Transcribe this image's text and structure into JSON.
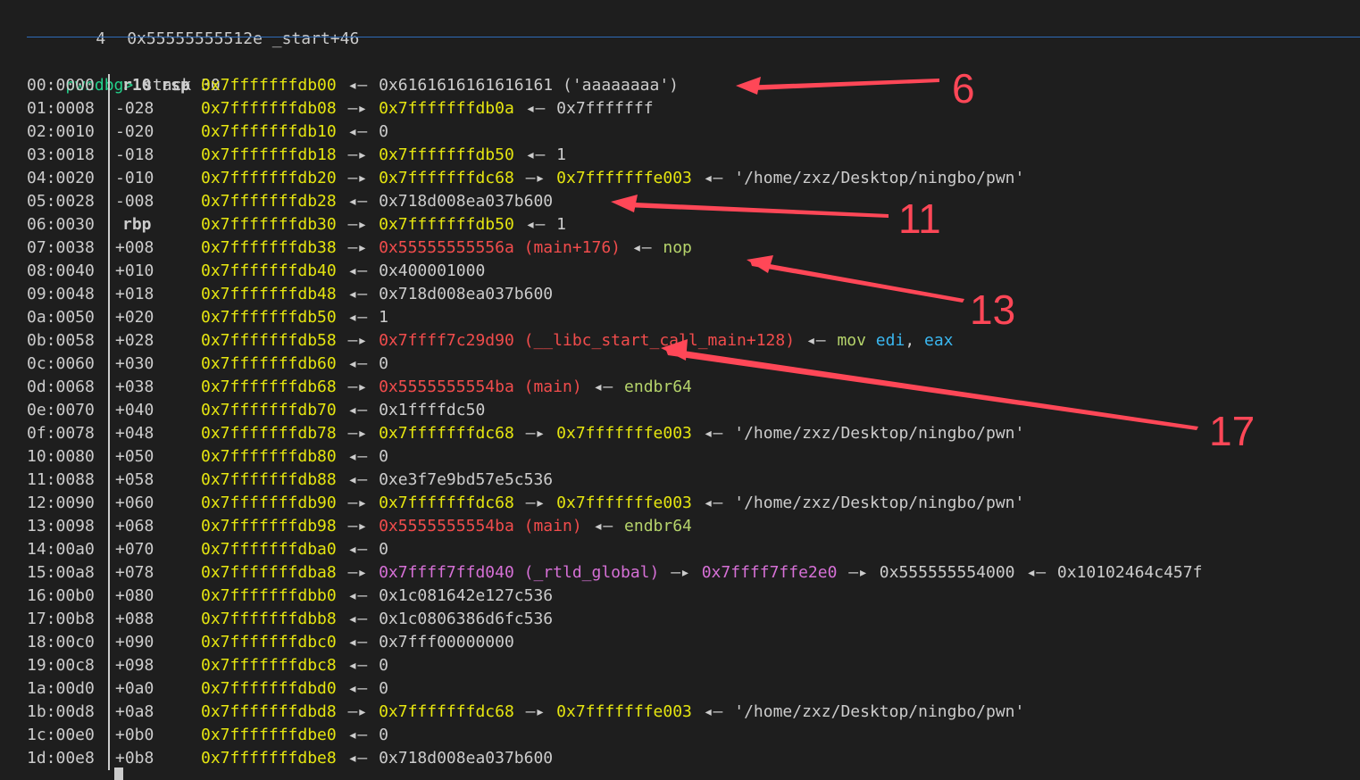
{
  "top": {
    "num": "4",
    "text": "0x55555555512e _start+46"
  },
  "prompt": {
    "label": "pwndbg>",
    "command": " stack 30"
  },
  "rows": [
    {
      "idx": "00:0000",
      "off": "r10 rsp",
      "isreg": true,
      "parts": [
        {
          "t": "addr",
          "v": "0x7fffffffdb00"
        },
        {
          "t": "arrow",
          "v": " ◂— "
        },
        {
          "t": "val",
          "v": "0x6161616161616161 ('aaaaaaaa')"
        }
      ]
    },
    {
      "idx": "01:0008",
      "off": "-028",
      "parts": [
        {
          "t": "addr",
          "v": "0x7fffffffdb08"
        },
        {
          "t": "arrow",
          "v": " —▸ "
        },
        {
          "t": "addr",
          "v": "0x7fffffffdb0a"
        },
        {
          "t": "arrow",
          "v": " ◂— "
        },
        {
          "t": "val",
          "v": "0x7fffffff"
        }
      ]
    },
    {
      "idx": "02:0010",
      "off": "-020",
      "parts": [
        {
          "t": "addr",
          "v": "0x7fffffffdb10"
        },
        {
          "t": "arrow",
          "v": " ◂— "
        },
        {
          "t": "val",
          "v": "0"
        }
      ]
    },
    {
      "idx": "03:0018",
      "off": "-018",
      "parts": [
        {
          "t": "addr",
          "v": "0x7fffffffdb18"
        },
        {
          "t": "arrow",
          "v": " —▸ "
        },
        {
          "t": "addr",
          "v": "0x7fffffffdb50"
        },
        {
          "t": "arrow",
          "v": " ◂— "
        },
        {
          "t": "val",
          "v": "1"
        }
      ]
    },
    {
      "idx": "04:0020",
      "off": "-010",
      "parts": [
        {
          "t": "addr",
          "v": "0x7fffffffdb20"
        },
        {
          "t": "arrow",
          "v": " —▸ "
        },
        {
          "t": "addr",
          "v": "0x7fffffffdc68"
        },
        {
          "t": "arrow",
          "v": " —▸ "
        },
        {
          "t": "addr",
          "v": "0x7fffffffe003"
        },
        {
          "t": "arrow",
          "v": " ◂— "
        },
        {
          "t": "val",
          "v": "'/home/zxz/Desktop/ningbo/pwn'"
        }
      ]
    },
    {
      "idx": "05:0028",
      "off": "-008",
      "parts": [
        {
          "t": "addr",
          "v": "0x7fffffffdb28"
        },
        {
          "t": "arrow",
          "v": " ◂— "
        },
        {
          "t": "val",
          "v": "0x718d008ea037b600"
        }
      ]
    },
    {
      "idx": "06:0030",
      "off": "rbp",
      "isreg": true,
      "parts": [
        {
          "t": "addr",
          "v": "0x7fffffffdb30"
        },
        {
          "t": "arrow",
          "v": " —▸ "
        },
        {
          "t": "addr",
          "v": "0x7fffffffdb50"
        },
        {
          "t": "arrow",
          "v": " ◂— "
        },
        {
          "t": "val",
          "v": "1"
        }
      ]
    },
    {
      "idx": "07:0038",
      "off": "+008",
      "parts": [
        {
          "t": "addr",
          "v": "0x7fffffffdb38"
        },
        {
          "t": "arrow",
          "v": " —▸ "
        },
        {
          "t": "code",
          "v": "0x55555555556a (main+176)"
        },
        {
          "t": "arrow",
          "v": " ◂— "
        },
        {
          "t": "instr",
          "v": "nop"
        }
      ]
    },
    {
      "idx": "08:0040",
      "off": "+010",
      "parts": [
        {
          "t": "addr",
          "v": "0x7fffffffdb40"
        },
        {
          "t": "arrow",
          "v": " ◂— "
        },
        {
          "t": "val",
          "v": "0x400001000"
        }
      ]
    },
    {
      "idx": "09:0048",
      "off": "+018",
      "parts": [
        {
          "t": "addr",
          "v": "0x7fffffffdb48"
        },
        {
          "t": "arrow",
          "v": " ◂— "
        },
        {
          "t": "val",
          "v": "0x718d008ea037b600"
        }
      ]
    },
    {
      "idx": "0a:0050",
      "off": "+020",
      "parts": [
        {
          "t": "addr",
          "v": "0x7fffffffdb50"
        },
        {
          "t": "arrow",
          "v": " ◂— "
        },
        {
          "t": "val",
          "v": "1"
        }
      ]
    },
    {
      "idx": "0b:0058",
      "off": "+028",
      "parts": [
        {
          "t": "addr",
          "v": "0x7fffffffdb58"
        },
        {
          "t": "arrow",
          "v": " —▸ "
        },
        {
          "t": "code",
          "v": "0x7ffff7c29d90 (__libc_start_call_main+128)"
        },
        {
          "t": "arrow",
          "v": " ◂— "
        },
        {
          "t": "instr",
          "v": "mov "
        },
        {
          "t": "reg",
          "v": "edi"
        },
        {
          "t": "val",
          "v": ", "
        },
        {
          "t": "reg",
          "v": "eax"
        }
      ]
    },
    {
      "idx": "0c:0060",
      "off": "+030",
      "parts": [
        {
          "t": "addr",
          "v": "0x7fffffffdb60"
        },
        {
          "t": "arrow",
          "v": " ◂— "
        },
        {
          "t": "val",
          "v": "0"
        }
      ]
    },
    {
      "idx": "0d:0068",
      "off": "+038",
      "parts": [
        {
          "t": "addr",
          "v": "0x7fffffffdb68"
        },
        {
          "t": "arrow",
          "v": " —▸ "
        },
        {
          "t": "code",
          "v": "0x5555555554ba (main)"
        },
        {
          "t": "arrow",
          "v": " ◂— "
        },
        {
          "t": "instr",
          "v": "endbr64"
        }
      ]
    },
    {
      "idx": "0e:0070",
      "off": "+040",
      "parts": [
        {
          "t": "addr",
          "v": "0x7fffffffdb70"
        },
        {
          "t": "arrow",
          "v": " ◂— "
        },
        {
          "t": "val",
          "v": "0x1ffffdc50"
        }
      ]
    },
    {
      "idx": "0f:0078",
      "off": "+048",
      "parts": [
        {
          "t": "addr",
          "v": "0x7fffffffdb78"
        },
        {
          "t": "arrow",
          "v": " —▸ "
        },
        {
          "t": "addr",
          "v": "0x7fffffffdc68"
        },
        {
          "t": "arrow",
          "v": " —▸ "
        },
        {
          "t": "addr",
          "v": "0x7fffffffe003"
        },
        {
          "t": "arrow",
          "v": " ◂— "
        },
        {
          "t": "val",
          "v": "'/home/zxz/Desktop/ningbo/pwn'"
        }
      ]
    },
    {
      "idx": "10:0080",
      "off": "+050",
      "parts": [
        {
          "t": "addr",
          "v": "0x7fffffffdb80"
        },
        {
          "t": "arrow",
          "v": " ◂— "
        },
        {
          "t": "val",
          "v": "0"
        }
      ]
    },
    {
      "idx": "11:0088",
      "off": "+058",
      "parts": [
        {
          "t": "addr",
          "v": "0x7fffffffdb88"
        },
        {
          "t": "arrow",
          "v": " ◂— "
        },
        {
          "t": "val",
          "v": "0xe3f7e9bd57e5c536"
        }
      ]
    },
    {
      "idx": "12:0090",
      "off": "+060",
      "parts": [
        {
          "t": "addr",
          "v": "0x7fffffffdb90"
        },
        {
          "t": "arrow",
          "v": " —▸ "
        },
        {
          "t": "addr",
          "v": "0x7fffffffdc68"
        },
        {
          "t": "arrow",
          "v": " —▸ "
        },
        {
          "t": "addr",
          "v": "0x7fffffffe003"
        },
        {
          "t": "arrow",
          "v": " ◂— "
        },
        {
          "t": "val",
          "v": "'/home/zxz/Desktop/ningbo/pwn'"
        }
      ]
    },
    {
      "idx": "13:0098",
      "off": "+068",
      "parts": [
        {
          "t": "addr",
          "v": "0x7fffffffdb98"
        },
        {
          "t": "arrow",
          "v": " —▸ "
        },
        {
          "t": "code",
          "v": "0x5555555554ba (main)"
        },
        {
          "t": "arrow",
          "v": " ◂— "
        },
        {
          "t": "instr",
          "v": "endbr64"
        }
      ]
    },
    {
      "idx": "14:00a0",
      "off": "+070",
      "parts": [
        {
          "t": "addr",
          "v": "0x7fffffffdba0"
        },
        {
          "t": "arrow",
          "v": " ◂— "
        },
        {
          "t": "val",
          "v": "0"
        }
      ]
    },
    {
      "idx": "15:00a8",
      "off": "+078",
      "parts": [
        {
          "t": "addr",
          "v": "0x7fffffffdba8"
        },
        {
          "t": "arrow",
          "v": " —▸ "
        },
        {
          "t": "data",
          "v": "0x7ffff7ffd040 (_rtld_global)"
        },
        {
          "t": "arrow",
          "v": " —▸ "
        },
        {
          "t": "data",
          "v": "0x7ffff7ffe2e0"
        },
        {
          "t": "arrow",
          "v": " —▸ "
        },
        {
          "t": "val",
          "v": "0x555555554000"
        },
        {
          "t": "arrow",
          "v": " ◂— "
        },
        {
          "t": "val",
          "v": "0x10102464c457f"
        }
      ]
    },
    {
      "idx": "16:00b0",
      "off": "+080",
      "parts": [
        {
          "t": "addr",
          "v": "0x7fffffffdbb0"
        },
        {
          "t": "arrow",
          "v": " ◂— "
        },
        {
          "t": "val",
          "v": "0x1c081642e127c536"
        }
      ]
    },
    {
      "idx": "17:00b8",
      "off": "+088",
      "parts": [
        {
          "t": "addr",
          "v": "0x7fffffffdbb8"
        },
        {
          "t": "arrow",
          "v": " ◂— "
        },
        {
          "t": "val",
          "v": "0x1c0806386d6fc536"
        }
      ]
    },
    {
      "idx": "18:00c0",
      "off": "+090",
      "parts": [
        {
          "t": "addr",
          "v": "0x7fffffffdbc0"
        },
        {
          "t": "arrow",
          "v": " ◂— "
        },
        {
          "t": "val",
          "v": "0x7fff00000000"
        }
      ]
    },
    {
      "idx": "19:00c8",
      "off": "+098",
      "parts": [
        {
          "t": "addr",
          "v": "0x7fffffffdbc8"
        },
        {
          "t": "arrow",
          "v": " ◂— "
        },
        {
          "t": "val",
          "v": "0"
        }
      ]
    },
    {
      "idx": "1a:00d0",
      "off": "+0a0",
      "parts": [
        {
          "t": "addr",
          "v": "0x7fffffffdbd0"
        },
        {
          "t": "arrow",
          "v": " ◂— "
        },
        {
          "t": "val",
          "v": "0"
        }
      ]
    },
    {
      "idx": "1b:00d8",
      "off": "+0a8",
      "parts": [
        {
          "t": "addr",
          "v": "0x7fffffffdbd8"
        },
        {
          "t": "arrow",
          "v": " —▸ "
        },
        {
          "t": "addr",
          "v": "0x7fffffffdc68"
        },
        {
          "t": "arrow",
          "v": " —▸ "
        },
        {
          "t": "addr",
          "v": "0x7fffffffe003"
        },
        {
          "t": "arrow",
          "v": " ◂— "
        },
        {
          "t": "val",
          "v": "'/home/zxz/Desktop/ningbo/pwn'"
        }
      ]
    },
    {
      "idx": "1c:00e0",
      "off": "+0b0",
      "parts": [
        {
          "t": "addr",
          "v": "0x7fffffffdbe0"
        },
        {
          "t": "arrow",
          "v": " ◂— "
        },
        {
          "t": "val",
          "v": "0"
        }
      ]
    },
    {
      "idx": "1d:00e8",
      "off": "+0b8",
      "parts": [
        {
          "t": "addr",
          "v": "0x7fffffffdbe8"
        },
        {
          "t": "arrow",
          "v": " ◂— "
        },
        {
          "t": "val",
          "v": "0x718d008ea037b600"
        }
      ]
    }
  ],
  "annotations": [
    {
      "label": "6"
    },
    {
      "label": "11"
    },
    {
      "label": "13"
    },
    {
      "label": "17"
    }
  ],
  "colors": {
    "background": "#1e1e1e",
    "prompt": "#23d18b",
    "address": "#e5e510",
    "code_pointer": "#f14c4c",
    "data_pointer": "#d670d6",
    "instruction": "#b5d36b",
    "register": "#3ab7f0",
    "annotation": "#ff4757",
    "separator": "#2e6bb8"
  }
}
